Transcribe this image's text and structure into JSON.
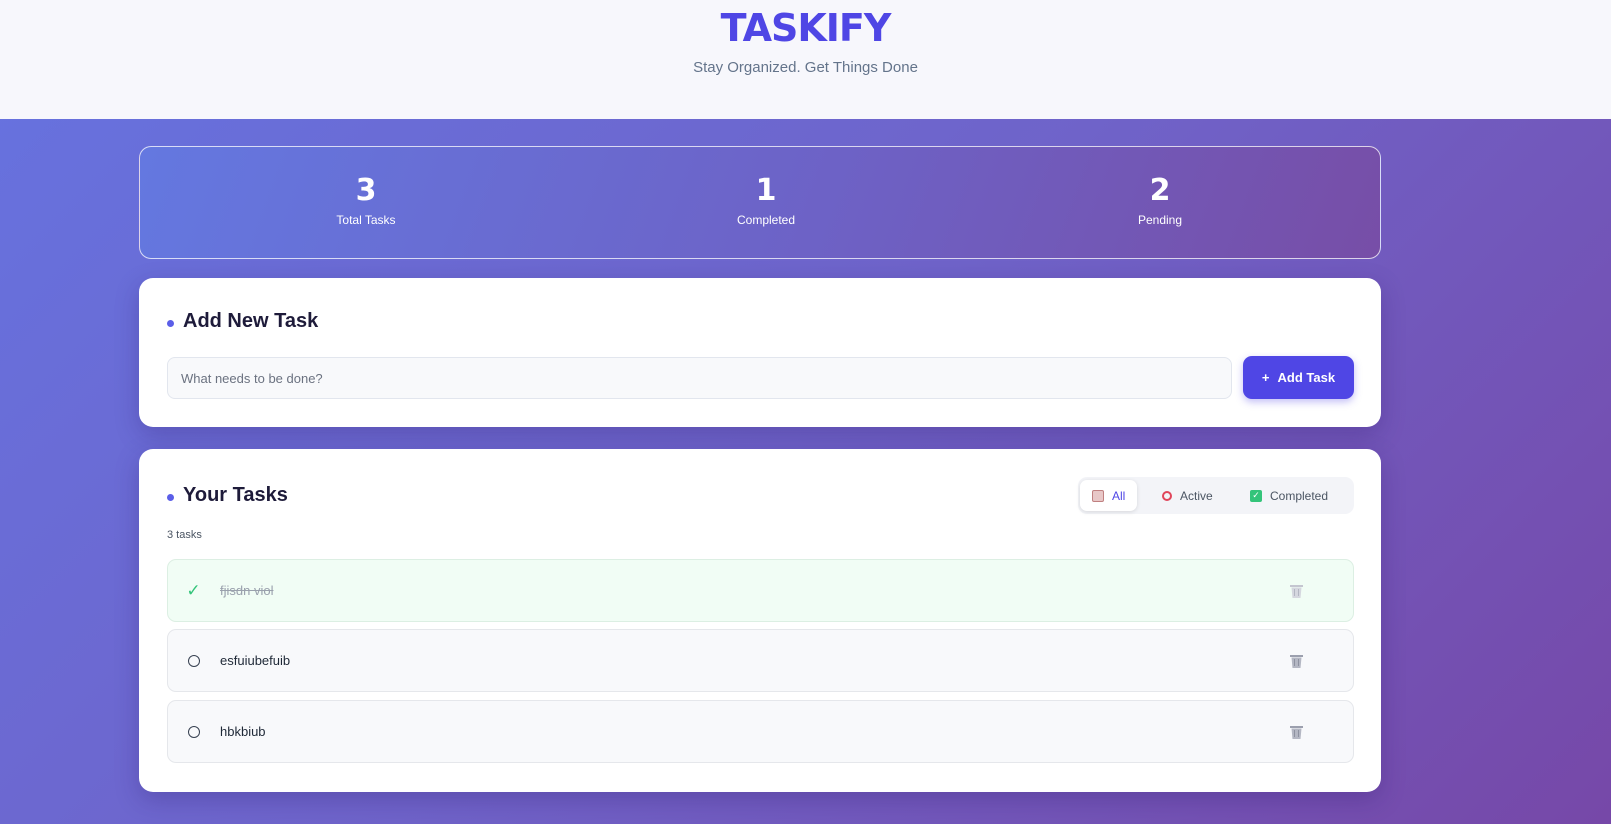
{
  "header": {
    "title": "TASKIFY",
    "tagline": "Stay Organized. Get Things Done"
  },
  "stats": [
    {
      "value": "3",
      "label": "Total Tasks"
    },
    {
      "value": "1",
      "label": "Completed"
    },
    {
      "value": "2",
      "label": "Pending"
    }
  ],
  "add_task": {
    "title": "Add New Task",
    "placeholder": "What needs to be done?",
    "input_value": "",
    "button_label": "Add Task",
    "button_icon": "+"
  },
  "tasks_section": {
    "title": "Your Tasks",
    "count_label": "3 tasks",
    "filters": [
      {
        "label": "All",
        "icon": "clipboard-icon",
        "active": true
      },
      {
        "label": "Active",
        "icon": "alarm-clock-icon",
        "active": false
      },
      {
        "label": "Completed",
        "icon": "check-box-icon",
        "active": false
      }
    ],
    "tasks": [
      {
        "text": "fjisdn viol",
        "completed": true
      },
      {
        "text": "esfuiubefuib",
        "completed": false
      },
      {
        "text": "hbkbiub",
        "completed": false
      }
    ]
  },
  "colors": {
    "brand": "#4f46e5",
    "success": "#34c47a",
    "background_start": "#6673e0",
    "background_end": "#7648a8"
  }
}
